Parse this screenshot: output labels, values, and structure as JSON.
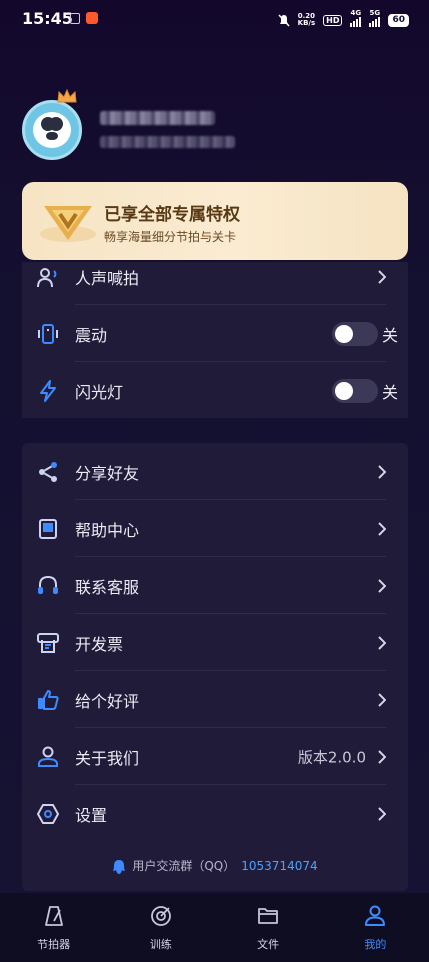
{
  "status_bar": {
    "time": "15:45",
    "speed_value": "0.20",
    "speed_unit": "KB/s",
    "hd_label": "HD",
    "signal1_label": "4G",
    "signal2_label": "5G",
    "battery": "60"
  },
  "vip": {
    "title": "已享全部专属特权",
    "subtitle": "畅享海量细分节拍与关卡"
  },
  "settings_top": {
    "voice_label": "人声喊拍",
    "vibrate_label": "震动",
    "vibrate_state": "关",
    "flash_label": "闪光灯",
    "flash_state": "关"
  },
  "menu": [
    {
      "label": "分享好友"
    },
    {
      "label": "帮助中心"
    },
    {
      "label": "联系客服"
    },
    {
      "label": "开发票"
    },
    {
      "label": "给个好评"
    },
    {
      "label": "关于我们",
      "value": "版本2.0.0"
    },
    {
      "label": "设置"
    }
  ],
  "qq_group": {
    "label": "用户交流群（QQ）",
    "number": "1053714074"
  },
  "bottom_nav": [
    {
      "label": "节拍器",
      "icon": "metronome-icon"
    },
    {
      "label": "训练",
      "icon": "target-icon"
    },
    {
      "label": "文件",
      "icon": "folder-icon"
    },
    {
      "label": "我的",
      "icon": "user-icon",
      "active": true
    }
  ],
  "colors": {
    "background": "#140f2e",
    "panel": "#1f1b38",
    "accent": "#3d8bff",
    "vip_gold": "#f6e4c4"
  }
}
